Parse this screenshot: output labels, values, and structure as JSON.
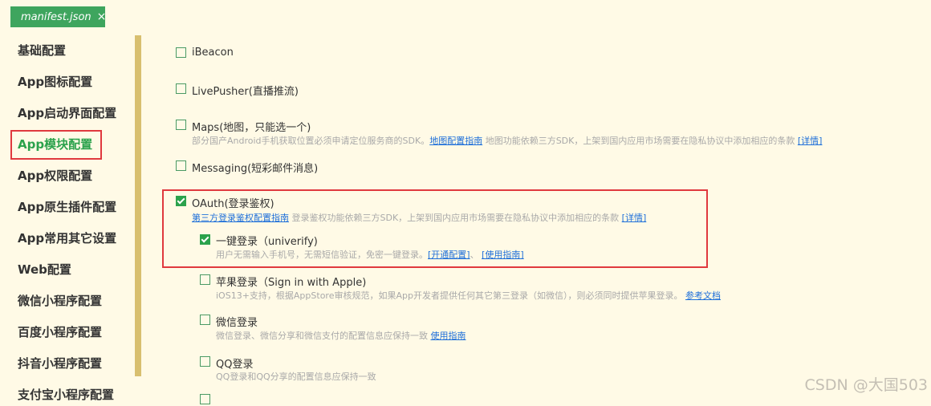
{
  "tab": {
    "title": "manifest.json",
    "close": "×"
  },
  "sidebar": {
    "items": [
      {
        "label": "基础配置"
      },
      {
        "label": "App图标配置"
      },
      {
        "label": "App启动界面配置"
      },
      {
        "label": "App模块配置"
      },
      {
        "label": "App权限配置"
      },
      {
        "label": "App原生插件配置"
      },
      {
        "label": "App常用其它设置"
      },
      {
        "label": "Web配置"
      },
      {
        "label": "微信小程序配置"
      },
      {
        "label": "百度小程序配置"
      },
      {
        "label": "抖音小程序配置"
      },
      {
        "label": "支付宝小程序配置"
      }
    ],
    "active_index": 3
  },
  "modules": {
    "ibeacon": {
      "label": "iBeacon",
      "checked": false
    },
    "livepusher": {
      "label": "LivePusher(直播推流)",
      "checked": false
    },
    "maps": {
      "label": "Maps(地图，只能选一个)",
      "checked": false,
      "desc": "部分国产Android手机获取位置必须申请定位服务商的SDK。",
      "link1": "地图配置指南",
      "desc2": " 地图功能依赖三方SDK，上架到国内应用市场需要在隐私协议中添加相应的条款 ",
      "link2": "[详情]"
    },
    "messaging": {
      "label": "Messaging(短彩邮件消息)",
      "checked": false
    },
    "oauth": {
      "label": "OAuth(登录鉴权)",
      "checked": true,
      "link1": "第三方登录鉴权配置指南",
      "desc": " 登录鉴权功能依赖三方SDK，上架到国内应用市场需要在隐私协议中添加相应的条款 ",
      "link2": "[详情]",
      "sub": {
        "univerify": {
          "label": "一键登录（univerify)",
          "checked": true,
          "desc": "用户无需输入手机号，无需短信验证，免密一键登录。",
          "link1": "[开通配置]",
          "sep": "、 ",
          "link2": "[使用指南]"
        },
        "apple": {
          "label": "苹果登录（Sign in with Apple)",
          "checked": false,
          "desc": "iOS13+支持，根据AppStore审核规范，如果App开发者提供任何其它第三登录（如微信），则必须同时提供苹果登录。",
          "link1": "参考文档"
        },
        "weixin": {
          "label": "微信登录",
          "checked": false,
          "desc": "微信登录、微信分享和微信支付的配置信息应保持一致 ",
          "link1": "使用指南"
        },
        "qq": {
          "label": "QQ登录",
          "checked": false,
          "desc": "QQ登录和QQ分享的配置信息应保持一致"
        }
      }
    }
  },
  "watermark": "CSDN @大国503",
  "colors": {
    "accent": "#2ba24c",
    "highlight": "#e0393e",
    "link": "#1e6fd9"
  }
}
